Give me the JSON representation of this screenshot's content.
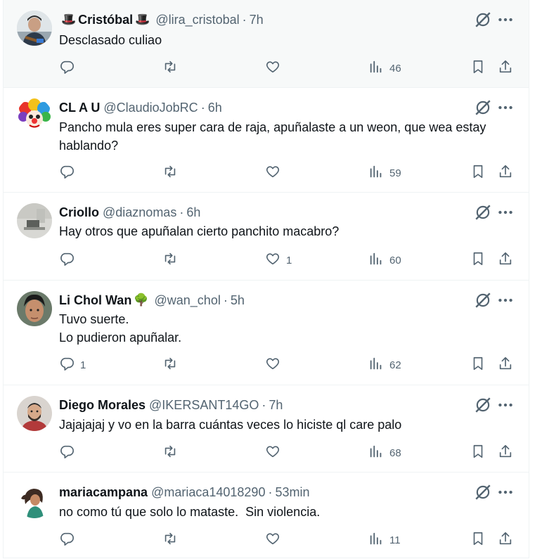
{
  "tweets": [
    {
      "name": "Cristóbal",
      "name_emoji_before": "🎩",
      "name_emoji_after": "🎩",
      "handle": "@lira_cristobal",
      "sep": "·",
      "time": "7h",
      "text": [
        "Desclasado culiao"
      ],
      "replies": "",
      "likes": "",
      "views": "46",
      "avatar_icon": "man-guitar-avatar"
    },
    {
      "name": "CL A U",
      "name_emoji_before": "",
      "name_emoji_after": "",
      "handle": "@ClaudioJobRC",
      "sep": "·",
      "time": "6h",
      "text": [
        "Pancho mula eres super cara de raja, apuñalaste a un weon, que wea estay",
        "hablando?"
      ],
      "replies": "",
      "likes": "",
      "views": "59",
      "avatar_icon": "clown-avatar"
    },
    {
      "name": "Criollo",
      "name_emoji_before": "",
      "name_emoji_after": "",
      "handle": "@diaznomas",
      "sep": "·",
      "time": "6h",
      "text": [
        "Hay otros que apuñalan cierto panchito macabro?"
      ],
      "replies": "",
      "likes": "1",
      "views": "60",
      "avatar_icon": "room-photo-avatar"
    },
    {
      "name": "Li Chol Wan",
      "name_emoji_before": "",
      "name_emoji_after": "🌳",
      "handle": "@wan_chol",
      "sep": "·",
      "time": "5h",
      "text": [
        "Tuvo suerte.",
        "Lo pudieron apuñalar."
      ],
      "replies": "1",
      "likes": "",
      "views": "62",
      "avatar_icon": "man-face-avatar"
    },
    {
      "name": "Diego Morales",
      "name_emoji_before": "",
      "name_emoji_after": "",
      "handle": "@IKERSANT14GO",
      "sep": "·",
      "time": "7h",
      "text": [
        "Jajajajaj y vo en la barra cuántas veces lo hiciste ql care palo"
      ],
      "replies": "",
      "likes": "",
      "views": "68",
      "avatar_icon": "bearded-man-avatar"
    },
    {
      "name": "mariacampana",
      "name_emoji_before": "",
      "name_emoji_after": "",
      "handle": "@mariaca14018290",
      "sep": "·",
      "time": "53min",
      "text": [
        "no como tú que solo lo mataste.  Sin violencia."
      ],
      "replies": "",
      "likes": "",
      "views": "11",
      "avatar_icon": "woman-illustration-avatar"
    }
  ],
  "colors": {
    "text": "#0f1419",
    "muted": "#536471",
    "border": "#eff3f4",
    "hover_bg": "#f7f9f9"
  }
}
